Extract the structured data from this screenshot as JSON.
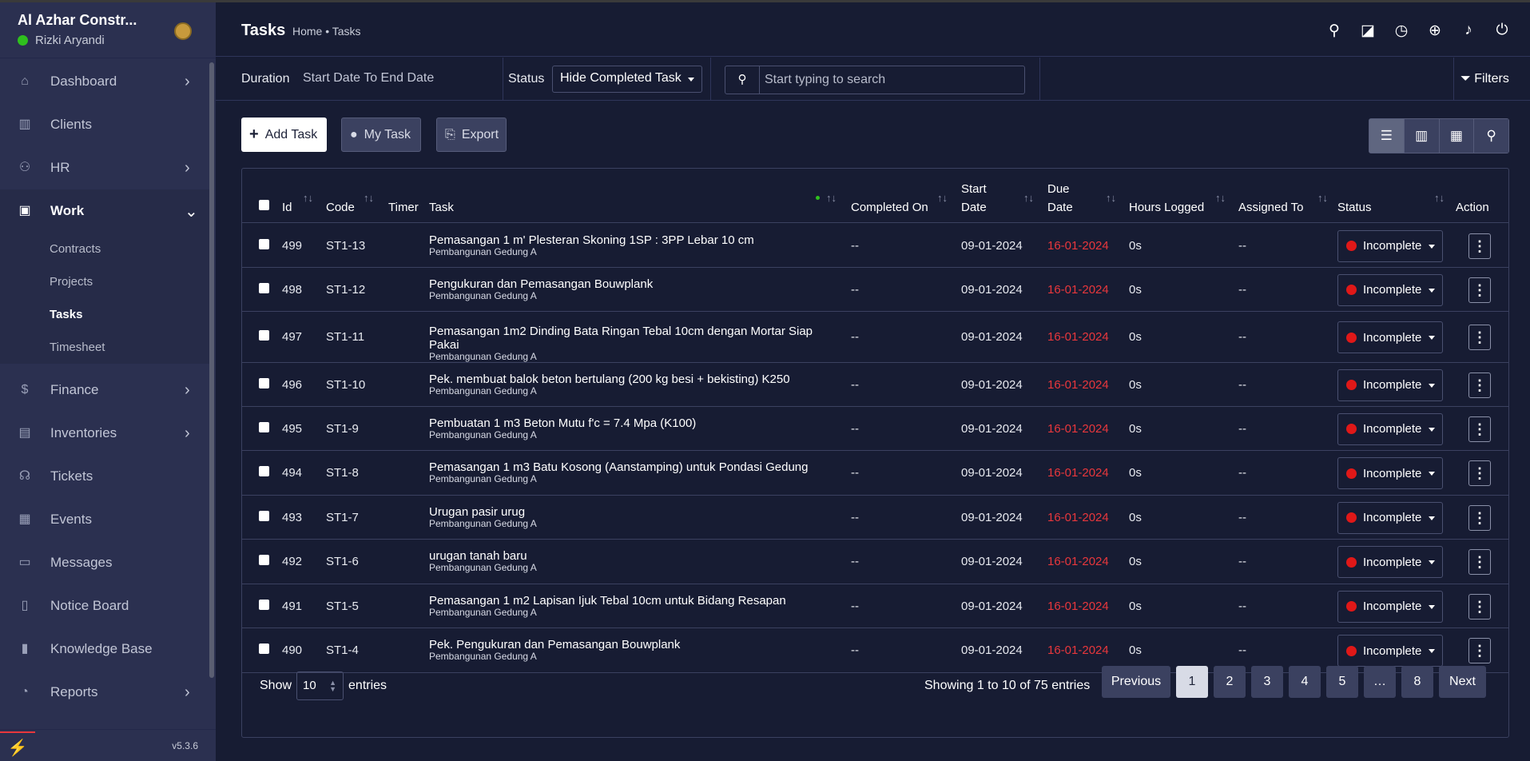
{
  "brand": {
    "name": "Al Azhar Constr...",
    "user": "Rizki Aryandi"
  },
  "nav": {
    "dashboard": "Dashboard",
    "clients": "Clients",
    "hr": "HR",
    "work": "Work",
    "contracts": "Contracts",
    "projects": "Projects",
    "tasks": "Tasks",
    "timesheet": "Timesheet",
    "finance": "Finance",
    "inventories": "Inventories",
    "tickets": "Tickets",
    "events": "Events",
    "messages": "Messages",
    "notice_board": "Notice Board",
    "knowledge_base": "Knowledge Base",
    "reports": "Reports"
  },
  "version": "v5.3.6",
  "header": {
    "title": "Tasks",
    "breadcrumb": "Home • Tasks"
  },
  "filters": {
    "duration_label": "Duration",
    "date_range": "Start Date To End Date",
    "status_label": "Status",
    "status_value": "Hide Completed Task",
    "search_placeholder": "Start typing to search",
    "filters_label": "Filters"
  },
  "actions": {
    "add": "Add Task",
    "my_task": "My Task",
    "export": "Export"
  },
  "table": {
    "headers": {
      "id": "Id",
      "code": "Code",
      "timer": "Timer",
      "task": "Task",
      "completed_on": "Completed On",
      "start_date_1": "Start",
      "start_date_2": "Date",
      "due_date_1": "Due",
      "due_date_2": "Date",
      "hours": "Hours Logged",
      "assigned": "Assigned To",
      "status": "Status",
      "action": "Action"
    },
    "rows": [
      {
        "id": "499",
        "code": "ST1-13",
        "task": "Pemasangan 1 m' Plesteran Skoning 1SP : 3PP Lebar 10 cm",
        "project": "Pembangunan Gedung A",
        "completed": "--",
        "start": "09-01-2024",
        "due": "16-01-2024",
        "hours": "0s",
        "assigned": "--",
        "status": "Incomplete"
      },
      {
        "id": "498",
        "code": "ST1-12",
        "task": "Pengukuran dan Pemasangan Bouwplank",
        "project": "Pembangunan Gedung A",
        "completed": "--",
        "start": "09-01-2024",
        "due": "16-01-2024",
        "hours": "0s",
        "assigned": "--",
        "status": "Incomplete"
      },
      {
        "id": "497",
        "code": "ST1-11",
        "task": "Pemasangan 1m2 Dinding Bata Ringan Tebal 10cm dengan Mortar Siap Pakai",
        "project": "Pembangunan Gedung A",
        "completed": "--",
        "start": "09-01-2024",
        "due": "16-01-2024",
        "hours": "0s",
        "assigned": "--",
        "status": "Incomplete"
      },
      {
        "id": "496",
        "code": "ST1-10",
        "task": "Pek. membuat balok beton bertulang (200 kg besi + bekisting) K250",
        "project": "Pembangunan Gedung A",
        "completed": "--",
        "start": "09-01-2024",
        "due": "16-01-2024",
        "hours": "0s",
        "assigned": "--",
        "status": "Incomplete"
      },
      {
        "id": "495",
        "code": "ST1-9",
        "task": "Pembuatan 1 m3 Beton Mutu f'c = 7.4 Mpa (K100)",
        "project": "Pembangunan Gedung A",
        "completed": "--",
        "start": "09-01-2024",
        "due": "16-01-2024",
        "hours": "0s",
        "assigned": "--",
        "status": "Incomplete"
      },
      {
        "id": "494",
        "code": "ST1-8",
        "task": "Pemasangan 1 m3 Batu Kosong (Aanstamping) untuk Pondasi Gedung",
        "project": "Pembangunan Gedung A",
        "completed": "--",
        "start": "09-01-2024",
        "due": "16-01-2024",
        "hours": "0s",
        "assigned": "--",
        "status": "Incomplete"
      },
      {
        "id": "493",
        "code": "ST1-7",
        "task": "Urugan pasir urug",
        "project": "Pembangunan Gedung A",
        "completed": "--",
        "start": "09-01-2024",
        "due": "16-01-2024",
        "hours": "0s",
        "assigned": "--",
        "status": "Incomplete"
      },
      {
        "id": "492",
        "code": "ST1-6",
        "task": "urugan tanah baru",
        "project": "Pembangunan Gedung A",
        "completed": "--",
        "start": "09-01-2024",
        "due": "16-01-2024",
        "hours": "0s",
        "assigned": "--",
        "status": "Incomplete"
      },
      {
        "id": "491",
        "code": "ST1-5",
        "task": "Pemasangan 1 m2 Lapisan Ijuk Tebal 10cm untuk Bidang Resapan",
        "project": "Pembangunan Gedung A",
        "completed": "--",
        "start": "09-01-2024",
        "due": "16-01-2024",
        "hours": "0s",
        "assigned": "--",
        "status": "Incomplete"
      },
      {
        "id": "490",
        "code": "ST1-4",
        "task": "Pek. Pengukuran dan Pemasangan Bouwplank",
        "project": "Pembangunan Gedung A",
        "completed": "--",
        "start": "09-01-2024",
        "due": "16-01-2024",
        "hours": "0s",
        "assigned": "--",
        "status": "Incomplete"
      }
    ]
  },
  "footer": {
    "show": "Show",
    "length": "10",
    "entries": "entries",
    "info": "Showing 1 to 10 of 75 entries",
    "pages": [
      "Previous",
      "1",
      "2",
      "3",
      "4",
      "5",
      "…",
      "8",
      "Next"
    ]
  },
  "colors": {
    "bg": "#171c33",
    "sidebar": "#2b3050",
    "accent_red": "#e01818",
    "due_red": "#e8373c",
    "online": "#2fc01e"
  }
}
